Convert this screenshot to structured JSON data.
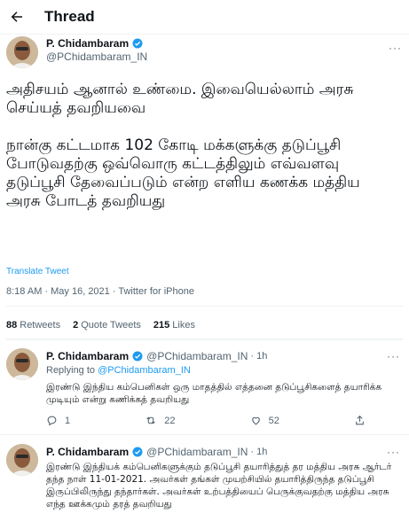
{
  "header": {
    "title": "Thread"
  },
  "tweet": {
    "author_name": "P. Chidambaram",
    "author_handle": "@PChidambaram_IN",
    "text": "அதிசயம் ஆனால் உண்மை. இவையெல்லாம் அரசு செய்யத் தவறியவை\n\nநான்கு கட்டமாக 102 கோடி மக்களுக்கு தடுப்பூசி போடுவதற்கு ஒவ்வொரு கட்டத்திலும் எவ்வளவு தடுப்பூசி தேவைப்படும் என்ற எளிய கணக்க மத்திய அரசு போடத் தவறியது",
    "translate_label": "Translate Tweet",
    "timestamp": "8:18 AM · May 16, 2021 · Twitter for iPhone",
    "stats": {
      "retweets_count": "88",
      "retweets_label": "Retweets",
      "quotes_count": "2",
      "quotes_label": "Quote Tweets",
      "likes_count": "215",
      "likes_label": "Likes"
    }
  },
  "replies": [
    {
      "author_name": "P. Chidambaram",
      "author_handle": "@PChidambaram_IN",
      "time": "· 1h",
      "replying_prefix": "Replying to",
      "replying_to": "@PChidambaram_IN",
      "text": "இரண்டு இந்திய கம்பெனிகள் ஒரு மாதத்தில் எத்தனை தடுப்பூசிகளைத் தயாரிக்க முடியும் என்று கணிக்கத் தவறியது",
      "reply_count": "1",
      "retweet_count": "22",
      "like_count": "52"
    },
    {
      "author_name": "P. Chidambaram",
      "author_handle": "@PChidambaram_IN",
      "time": "· 1h",
      "text": "இரண்டு இந்தியக் கம்பெனிகளுக்கும் தடுப்பூசி தயாரித்துத் தர மத்திய அரசு ஆர்டர் தந்த நாள் 11-01-2021. அவர்கள் தங்கள் முயற்சியில் தயாரித்திருந்த தடுப்பூசி இருப்பிலிருந்து தந்தார்கள். அவர்கள் உற்பத்தியைப் பெருக்குவதற்கு மத்திய அரசு எந்த ஊக்கமும் தரத் தவறியது"
    }
  ],
  "colors": {
    "accent": "#1d9bf0",
    "text": "#0f1419",
    "muted": "#536471",
    "divider": "#eff3f4"
  }
}
